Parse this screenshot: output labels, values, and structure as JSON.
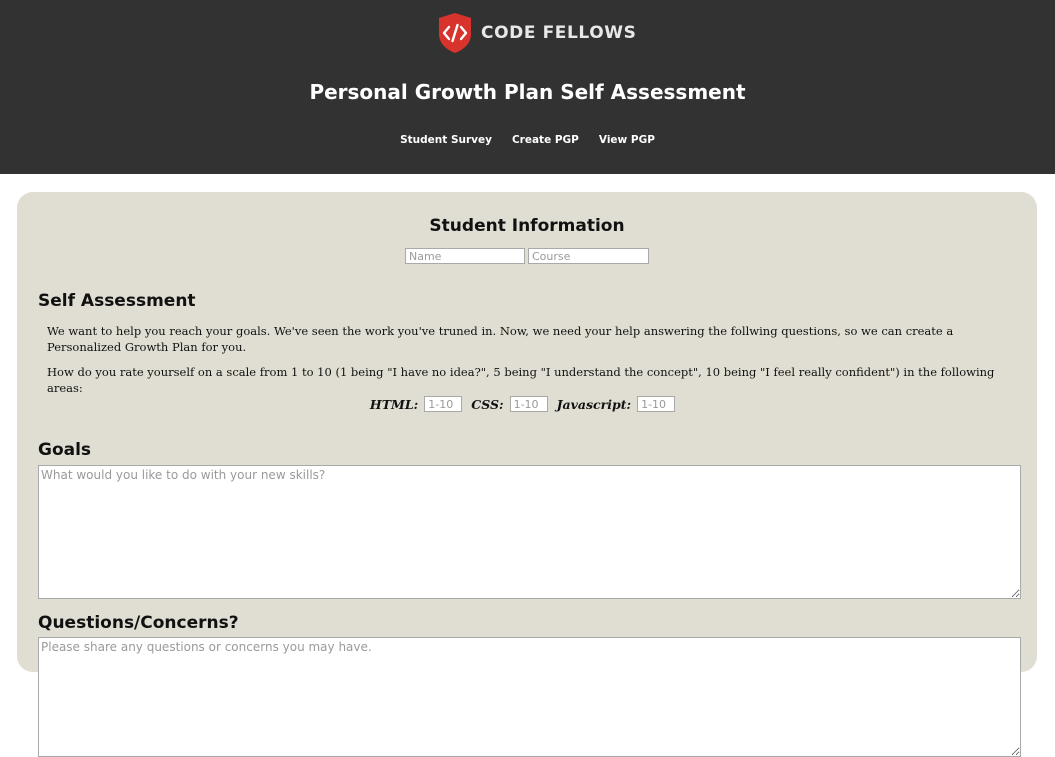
{
  "brand": {
    "logo_icon": "code-brackets-shield-icon",
    "name": "CODE FELLOWS",
    "accent_color": "#d9332e"
  },
  "header": {
    "title": "Personal Growth Plan Self Assessment",
    "nav": [
      "Student Survey",
      "Create PGP",
      "View PGP"
    ]
  },
  "student_info": {
    "title": "Student Information",
    "name_placeholder": "Name",
    "course_placeholder": "Course"
  },
  "self_assessment": {
    "title": "Self Assessment",
    "intro": "We want to help you reach your goals. We've seen the work you've truned in. Now, we need your help answering the follwing questions, so we can create a Personalized Growth Plan for you.",
    "question": "How do you rate yourself on a scale from 1 to 10 (1 being \"I have no idea?\", 5 being \"I understand the concept\", 10 being \"I feel really confident\") in the following areas:",
    "ratings": [
      {
        "label": "HTML:",
        "placeholder": "1-10"
      },
      {
        "label": "CSS:",
        "placeholder": "1-10"
      },
      {
        "label": "Javascript:",
        "placeholder": "1-10"
      }
    ]
  },
  "goals": {
    "title": "Goals",
    "placeholder": "What would you like to do with your new skills?"
  },
  "questions": {
    "title": "Questions/Concerns?",
    "placeholder": "Please share any questions or concerns you may have."
  },
  "colors": {
    "header_bg": "#323232",
    "card_bg": "#e0ded2"
  }
}
